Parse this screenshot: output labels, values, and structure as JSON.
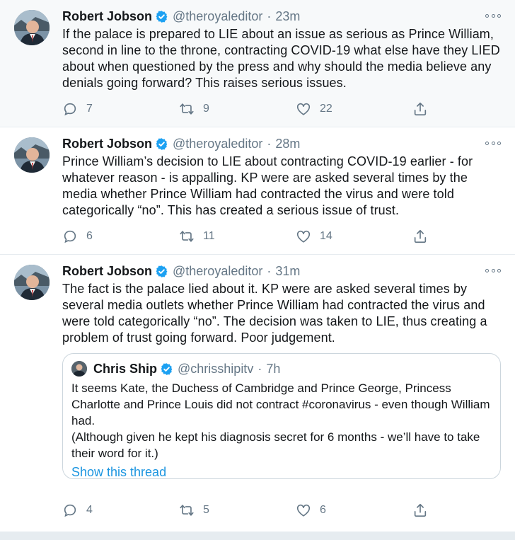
{
  "colors": {
    "accent": "#1b95e0",
    "verified": "#1da1f2",
    "muted": "#657786",
    "text": "#14171a"
  },
  "icons": {
    "reply": "reply-icon",
    "retweet": "retweet-icon",
    "like": "heart-icon",
    "share": "share-icon",
    "more": "more-options-icon",
    "verified": "verified-badge-icon"
  },
  "tweets": [
    {
      "name": "Robert Jobson",
      "handle": "@theroyaleditor",
      "sep": "·",
      "time": "23m",
      "text": "If the palace is prepared to LIE about an issue as serious as Prince William, second in line to the throne, contracting COVID-19 what else have they LIED about when questioned by the press and why should the media believe any denials going forward? This raises serious issues.",
      "replies": "7",
      "retweets": "9",
      "likes": "22"
    },
    {
      "name": "Robert Jobson",
      "handle": "@theroyaleditor",
      "sep": "·",
      "time": "28m",
      "text": "Prince William’s decision to LIE about contracting COVID-19 earlier - for whatever reason - is appalling. KP were are asked several times by the media whether Prince William had contracted the virus and were told categorically “no”. This has created a serious issue of trust.",
      "replies": "6",
      "retweets": "11",
      "likes": "14"
    },
    {
      "name": "Robert Jobson",
      "handle": "@theroyaleditor",
      "sep": "·",
      "time": "31m",
      "text": "The fact is the palace lied about it. KP were are asked several times by several media outlets whether Prince William had contracted the virus and were told categorically “no”. The decision was taken to LIE, thus creating a problem of trust going forward. Poor judgement.",
      "replies": "4",
      "retweets": "5",
      "likes": "6",
      "quote": {
        "name": "Chris Ship",
        "handle": "@chrisshipitv",
        "sep": "·",
        "time": "7h",
        "text_line1": "It seems Kate, the Duchess of Cambridge and Prince George, Princess Charlotte and Prince Louis did not contract #coronavirus - even though William had.",
        "text_line2": "(Although given he kept his diagnosis secret for 6 months - we’ll have to take their word for it.)",
        "link": "Show this thread"
      }
    }
  ]
}
